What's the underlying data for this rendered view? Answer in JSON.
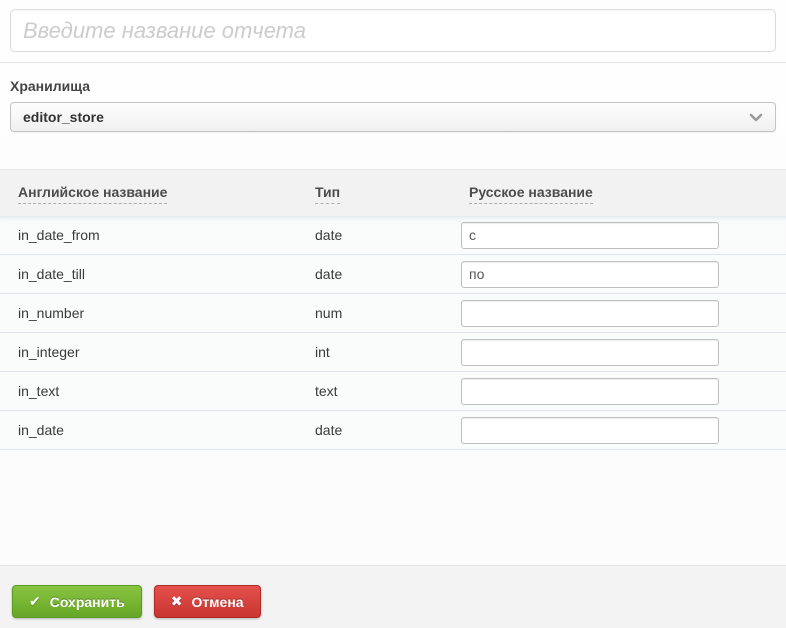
{
  "report_name_input": {
    "placeholder": "Введите название отчета",
    "value": ""
  },
  "storage": {
    "label": "Хранилища",
    "selected_value": "editor_store"
  },
  "table": {
    "columns": [
      {
        "label": "Английское название"
      },
      {
        "label": "Тип"
      },
      {
        "label": "Русское название"
      }
    ],
    "rows": [
      {
        "en": "in_date_from",
        "type": "date",
        "ru": "с"
      },
      {
        "en": "in_date_till",
        "type": "date",
        "ru": "по"
      },
      {
        "en": "in_number",
        "type": "num",
        "ru": ""
      },
      {
        "en": "in_integer",
        "type": "int",
        "ru": ""
      },
      {
        "en": "in_text",
        "type": "text",
        "ru": ""
      },
      {
        "en": "in_date",
        "type": "date",
        "ru": ""
      }
    ]
  },
  "footer": {
    "save_label": "Сохранить",
    "cancel_label": "Отмена",
    "check_icon": "✔",
    "cross_icon": "✖"
  },
  "colors": {
    "save_green": "#68a627",
    "cancel_red": "#c93632",
    "header_bg": "#f2f2f2",
    "row_separator": "#dde4e9"
  }
}
